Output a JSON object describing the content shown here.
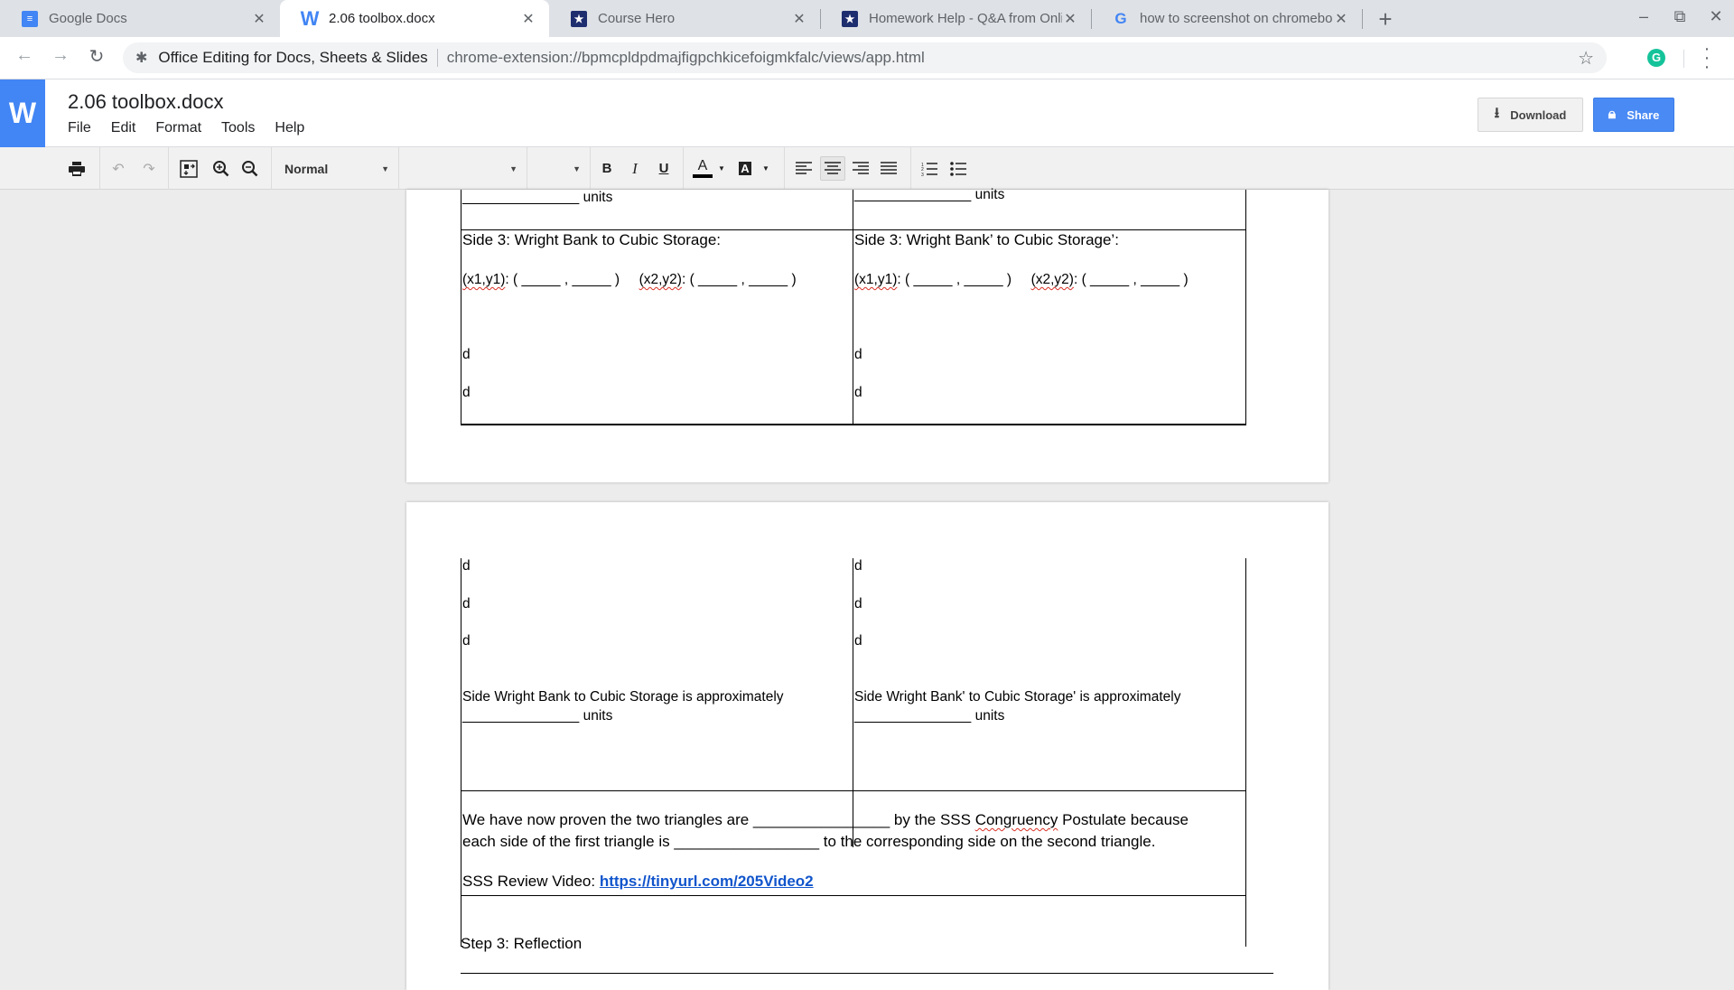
{
  "browser": {
    "tabs": [
      {
        "title": "Google Docs",
        "icon": "google-docs-icon",
        "active": false
      },
      {
        "title": "2.06 toolbox.docx",
        "icon": "word-icon",
        "active": true
      },
      {
        "title": "Course Hero",
        "icon": "course-hero-icon",
        "active": false
      },
      {
        "title": "Homework Help - Q&A from Onlin",
        "icon": "course-hero-icon",
        "active": false
      },
      {
        "title": "how to screenshot on chromebo",
        "icon": "google-icon",
        "active": false
      }
    ],
    "new_tab_glyph": "+",
    "close_glyph": "✕",
    "window": {
      "minimize": "–",
      "restore": "⧉",
      "close": "✕"
    },
    "nav": {
      "back": "←",
      "forward": "→",
      "reload": "↻"
    },
    "omnibox": {
      "extension_name": "Office Editing for Docs, Sheets & Slides",
      "url": "chrome-extension://bpmcpldpdmajfigpchkicefoigmkfalc/views/app.html",
      "star_glyph": "☆"
    },
    "extensions": {
      "grammarly": "G",
      "menu": "⋮"
    }
  },
  "app": {
    "logo": "W",
    "doc_title": "2.06 toolbox.docx",
    "menu": [
      "File",
      "Edit",
      "Format",
      "Tools",
      "Help"
    ],
    "download_label": "Download",
    "share_label": "Share",
    "accent_color": "#4285f4"
  },
  "toolbar": {
    "style_value": "Normal",
    "font_value": "",
    "size_value": "",
    "bold": "B",
    "italic": "I",
    "underline": "U",
    "font_color": "A",
    "highlight": "A",
    "alignment_selected": "center"
  },
  "document": {
    "page1": {
      "top_left_units": "_______________ units",
      "top_right_units": "_______________ units",
      "left_heading": "Side 3: Wright Bank to Cubic Storage:",
      "right_heading": "Side 3: Wright Bank’ to Cubic Storage’:",
      "coords": {
        "p1_label": "(x1,y1)",
        "p1_blank": ": ( _____ , _____ )",
        "p2_label": "(x2,y2)",
        "p2_blank": ": ( _____ , _____ )"
      },
      "d_lines": [
        "d",
        "d"
      ]
    },
    "page2": {
      "d_lines": [
        "d",
        "d",
        "d"
      ],
      "left_result_line1": "Side Wright Bank to Cubic Storage is approximately",
      "right_result_line1": "Side Wright Bank' to Cubic Storage' is approximately",
      "result_line2": "_______________ units",
      "conclusion_part1": "We have now proven the two triangles are ________________ by the SSS ",
      "conclusion_squiggle": "Congruency",
      "conclusion_part2": " Postulate because",
      "conclusion_line2": "each side of the first triangle is _________________ to the corresponding side on the second triangle.",
      "video_label": "SSS Review Video:  ",
      "video_link": "https://tinyurl.com/205Video2",
      "step3": "Step 3: Reflection"
    }
  }
}
